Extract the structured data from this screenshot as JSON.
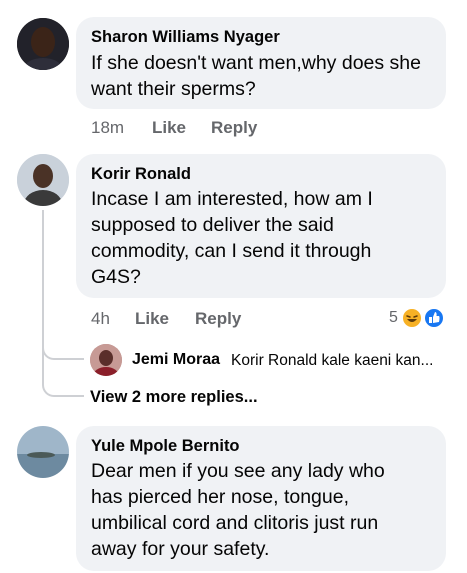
{
  "comments": [
    {
      "author": "Sharon Williams Nyager",
      "text": "If she doesn't want men,why does she want their sperms?",
      "time": "18m",
      "like_label": "Like",
      "reply_label": "Reply"
    },
    {
      "author": "Korir Ronald",
      "text": "Incase I am interested, how am I supposed to deliver the said commodity, can I send it through G4S?",
      "time": "4h",
      "like_label": "Like",
      "reply_label": "Reply",
      "reaction_count": "5",
      "reactions": [
        "haha-icon",
        "like-icon"
      ],
      "reply_preview": {
        "author": "Jemi Moraa",
        "text": "Korir Ronald kale kaeni kan..."
      },
      "view_more_label": "View 2 more replies..."
    },
    {
      "author": "Yule Mpole Bernito",
      "text": "Dear men if you see any lady who has pierced her nose, tongue, umbilical cord and clitoris just run away for your safety."
    }
  ],
  "colors": {
    "bubble": "#f0f2f5",
    "meta": "#65676b",
    "like_blue": "#1877f2",
    "haha_yellow": "#f7b125"
  }
}
